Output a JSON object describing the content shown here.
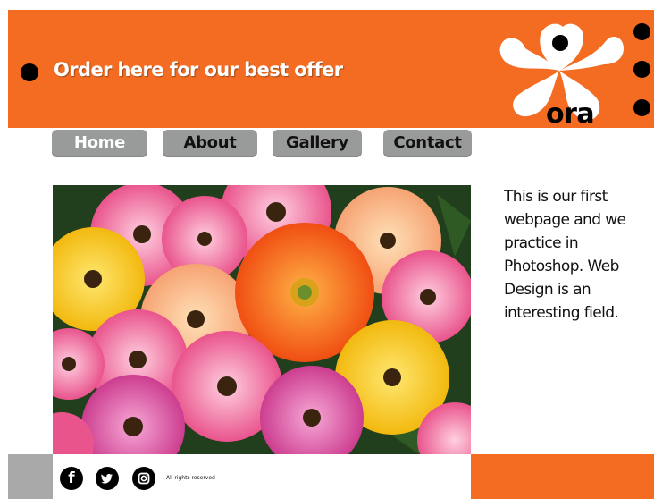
{
  "header": {
    "offer_text": "Order here for our best offer",
    "logo_text": "ora",
    "background": "#f36c22"
  },
  "nav": {
    "items": [
      {
        "label": "Home",
        "active": true
      },
      {
        "label": "About",
        "active": false
      },
      {
        "label": "Gallery",
        "active": false
      },
      {
        "label": "Contact",
        "active": false
      }
    ],
    "button_color": "#999a9a"
  },
  "main": {
    "image": "gerbera-daisies-photo",
    "intro_text": "This is our first webpage  and we practice in Photoshop. Web Design is an interesting field."
  },
  "footer": {
    "social": [
      "facebook-icon",
      "twitter-icon",
      "instagram-icon"
    ],
    "copyright": "All rights reserved"
  }
}
